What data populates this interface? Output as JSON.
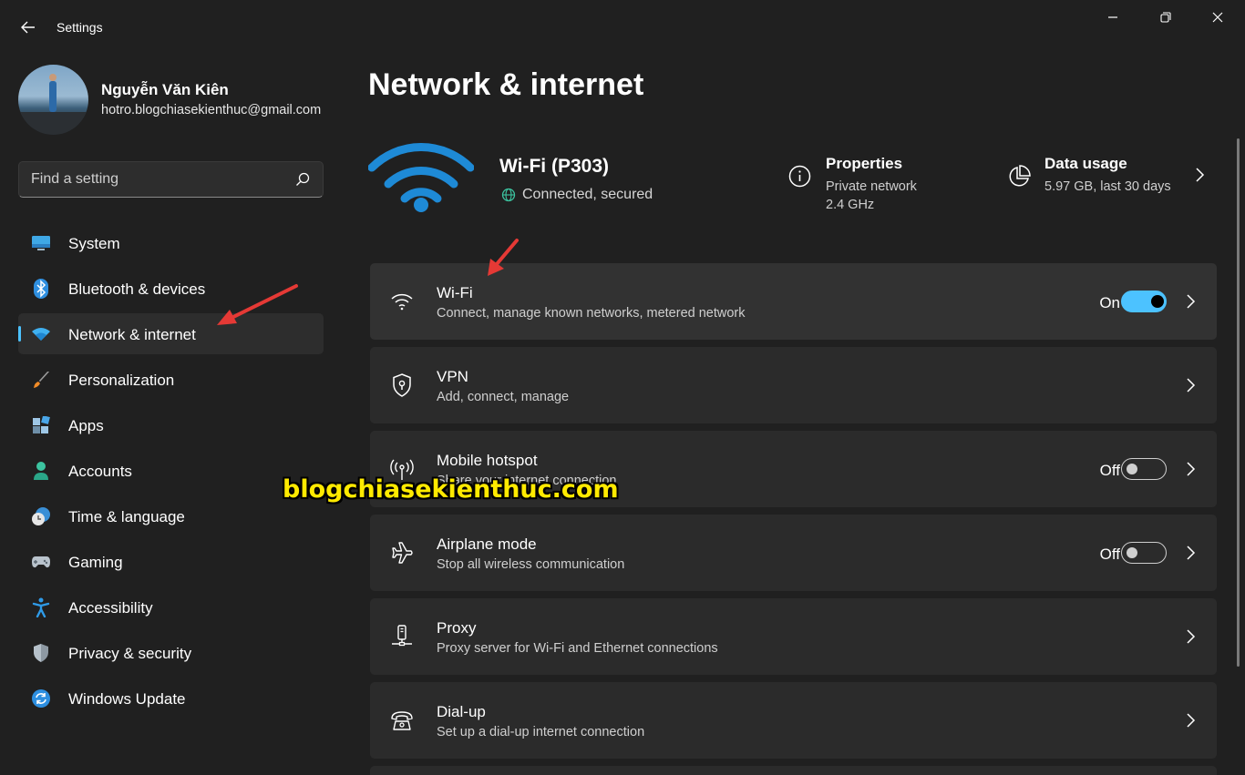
{
  "window": {
    "title": "Settings"
  },
  "profile": {
    "name": "Nguyễn Văn Kiên",
    "email": "hotro.blogchiasekienthuc@gmail.com"
  },
  "search": {
    "placeholder": "Find a setting"
  },
  "sidebar": {
    "items": [
      {
        "label": "System",
        "icon": "monitor-icon"
      },
      {
        "label": "Bluetooth & devices",
        "icon": "bluetooth-icon"
      },
      {
        "label": "Network & internet",
        "icon": "wifi-icon",
        "active": true
      },
      {
        "label": "Personalization",
        "icon": "brush-icon"
      },
      {
        "label": "Apps",
        "icon": "apps-icon"
      },
      {
        "label": "Accounts",
        "icon": "person-icon"
      },
      {
        "label": "Time & language",
        "icon": "clock-globe-icon"
      },
      {
        "label": "Gaming",
        "icon": "gamepad-icon"
      },
      {
        "label": "Accessibility",
        "icon": "accessibility-icon"
      },
      {
        "label": "Privacy & security",
        "icon": "shield-icon"
      },
      {
        "label": "Windows Update",
        "icon": "update-icon"
      }
    ]
  },
  "main": {
    "title": "Network & internet",
    "network": {
      "name": "Wi-Fi (P303)",
      "status": "Connected, secured"
    },
    "properties": {
      "title": "Properties",
      "line1": "Private network",
      "line2": "2.4 GHz"
    },
    "data_usage": {
      "title": "Data usage",
      "line1": "5.97 GB, last 30 days"
    },
    "cards": [
      {
        "title": "Wi-Fi",
        "desc": "Connect, manage known networks, metered network",
        "state": "On",
        "toggle": true,
        "icon": "wifi-icon"
      },
      {
        "title": "VPN",
        "desc": "Add, connect, manage",
        "icon": "vpn-shield-icon"
      },
      {
        "title": "Mobile hotspot",
        "desc": "Share your internet connection",
        "state": "Off",
        "toggle": false,
        "icon": "hotspot-icon"
      },
      {
        "title": "Airplane mode",
        "desc": "Stop all wireless communication",
        "state": "Off",
        "toggle": false,
        "icon": "airplane-icon"
      },
      {
        "title": "Proxy",
        "desc": "Proxy server for Wi-Fi and Ethernet connections",
        "icon": "proxy-icon"
      },
      {
        "title": "Dial-up",
        "desc": "Set up a dial-up internet connection",
        "icon": "dialup-icon"
      }
    ]
  },
  "watermark": "blogchiasekienthuc.com",
  "colors": {
    "accent": "#4cc2ff",
    "background": "#202020",
    "card": "#2b2b2b",
    "annotation_arrow": "#e53935",
    "watermark": "#ffea00"
  }
}
